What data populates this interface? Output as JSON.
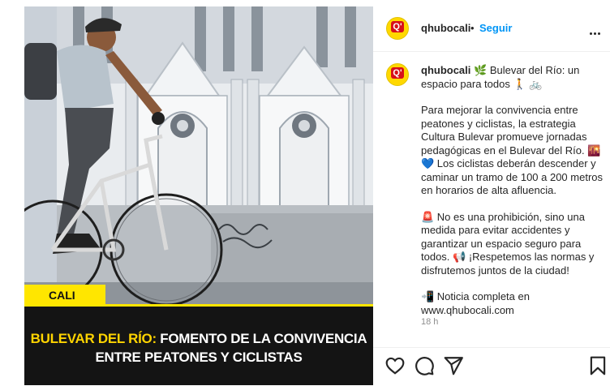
{
  "post": {
    "cali_tag": "CALI",
    "headline_part1_yellow": "BULEVAR DEL RÍO:",
    "headline_part1_white": " FOMENTO DE LA CONVIVENCIA",
    "headline_line2": "ENTRE PEATONES Y CICLISTAS"
  },
  "header": {
    "avatar_text": "Q'",
    "username": "qhubocali",
    "separator": "•",
    "follow_label": "Seguir",
    "more_icon": "more-horizontal-icon"
  },
  "caption": {
    "username": "qhubocali",
    "title": "🌿 Bulevar del Río: un espacio para todos 🚶 🚲",
    "paragraph1": "Para mejorar la convivencia entre peatones y ciclistas, la estrategia Cultura Bulevar promueve jornadas pedagógicas en el Bulevar del Río. 🌇💙 Los ciclistas deberán descender y caminar un tramo de 100 a 200 metros en horarios de alta afluencia.",
    "paragraph2": "🚨 No es una prohibición, sino una medida para evitar accidentes y garantizar un espacio seguro para todos. 📢 ¡Respetemos las normas y disfrutemos juntos de la ciudad!",
    "paragraph3": "📲 Noticia completa en www.qhubocali.com",
    "time": "18 h"
  },
  "actions": {
    "like_icon": "heart-icon",
    "comment_icon": "comment-icon",
    "share_icon": "send-icon",
    "save_icon": "bookmark-icon"
  },
  "colors": {
    "brand_yellow": "#ffd800",
    "brand_red": "#d7101a",
    "follow_blue": "#0095f6",
    "headline_bg": "#141414"
  }
}
